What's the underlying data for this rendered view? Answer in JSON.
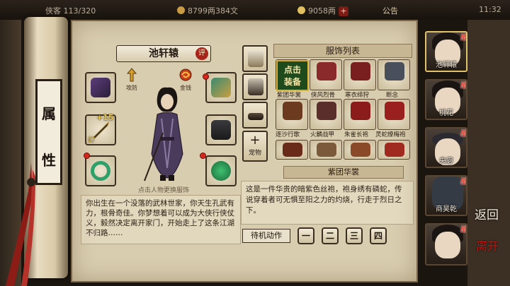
{
  "topbar": {
    "name_truncated": "侠客",
    "slots": "113/320",
    "silver": "8799两384文",
    "gold": "9058两",
    "plus": "+",
    "announcement": "公告",
    "time": "11:32"
  },
  "side_plaque": {
    "line1": "属",
    "line2": "性"
  },
  "character": {
    "name": "池轩辕",
    "eval_badge": "评",
    "hint": "点击人物更换服饰",
    "stats": [
      {
        "label": "攻防",
        "icon": "arrows-icon"
      },
      {
        "label": "金钱",
        "icon": "fire-swirl-icon"
      }
    ],
    "equip_slots": [
      {
        "name": "gloves",
        "icon": "purple-gloves-icon"
      },
      {
        "name": "weapon",
        "icon": "spear-icon",
        "level": "+15",
        "grade": "幻"
      },
      {
        "name": "ring",
        "icon": "jade-bracelet-icon"
      },
      {
        "name": "helmet",
        "icon": "helmet-icon"
      },
      {
        "name": "armor",
        "icon": "armor-icon"
      },
      {
        "name": "amulet",
        "icon": "jade-pendant-icon"
      }
    ],
    "bio": "你出生在一个没落的武林世家，你天生孔武有力，根骨奇佳。你梦想着可以成为大侠行侠仗义，毅然决定离开家门，开始走上了这条江湖不归路……"
  },
  "side_tabs": [
    {
      "name": "costume-tab",
      "icon": "robe-icon"
    },
    {
      "name": "hat-tab",
      "icon": "hat-icon"
    },
    {
      "name": "belt-tab",
      "icon": "belt-icon"
    }
  ],
  "pet_tab": {
    "plus": "+",
    "label": "宠物"
  },
  "costume_list": {
    "title": "服饰列表",
    "equip_label_1": "点击",
    "equip_label_2": "装备",
    "items": [
      {
        "name": "紫团华裳",
        "color": "#6a4a8a"
      },
      {
        "name": "侠风烈骨",
        "color": "#8a2a2a"
      },
      {
        "name": "寒衣缔狩",
        "color": "#7a1f1f"
      },
      {
        "name": "断念",
        "color": "#4a4f5c"
      },
      {
        "name": "逐沙行歌",
        "color": "#6b3a1f"
      },
      {
        "name": "火麟战甲",
        "color": "#5a2e2a"
      },
      {
        "name": "朱雀长袍",
        "color": "#8b1c1c"
      },
      {
        "name": "灵蛇缭梅袍",
        "color": "#9a2020"
      },
      {
        "name": "",
        "color": "#6a2a1a"
      },
      {
        "name": "",
        "color": "#7a5a3a"
      },
      {
        "name": "",
        "color": "#8a4a2a"
      },
      {
        "name": "",
        "color": "#a02a20"
      }
    ]
  },
  "description": {
    "title": "紫团华裳",
    "text": "这是一件华贵的暗紫色丝袍，袍身绣有磷蛇，传说穿着者可无惧至阳之力的灼烧，行走于烈日之下。"
  },
  "idle_action": {
    "label": "待机动作",
    "buttons": [
      "一",
      "二",
      "三",
      "四"
    ]
  },
  "roster": [
    {
      "name": "池轩辕",
      "tag": "战",
      "active": true,
      "hair": "#1a1412"
    },
    {
      "name": "桃花",
      "tag": "战",
      "active": false,
      "hair": "#1c1513"
    },
    {
      "name": "央宓",
      "tag": "战",
      "active": false,
      "hair": "#2a2a30"
    },
    {
      "name": "商昊乾",
      "tag": "战",
      "active": false,
      "hair": "#353b45"
    },
    {
      "name": "",
      "tag": "战",
      "active": false,
      "hair": "#171210"
    }
  ],
  "back_label": "返回",
  "leave_label": "离开"
}
